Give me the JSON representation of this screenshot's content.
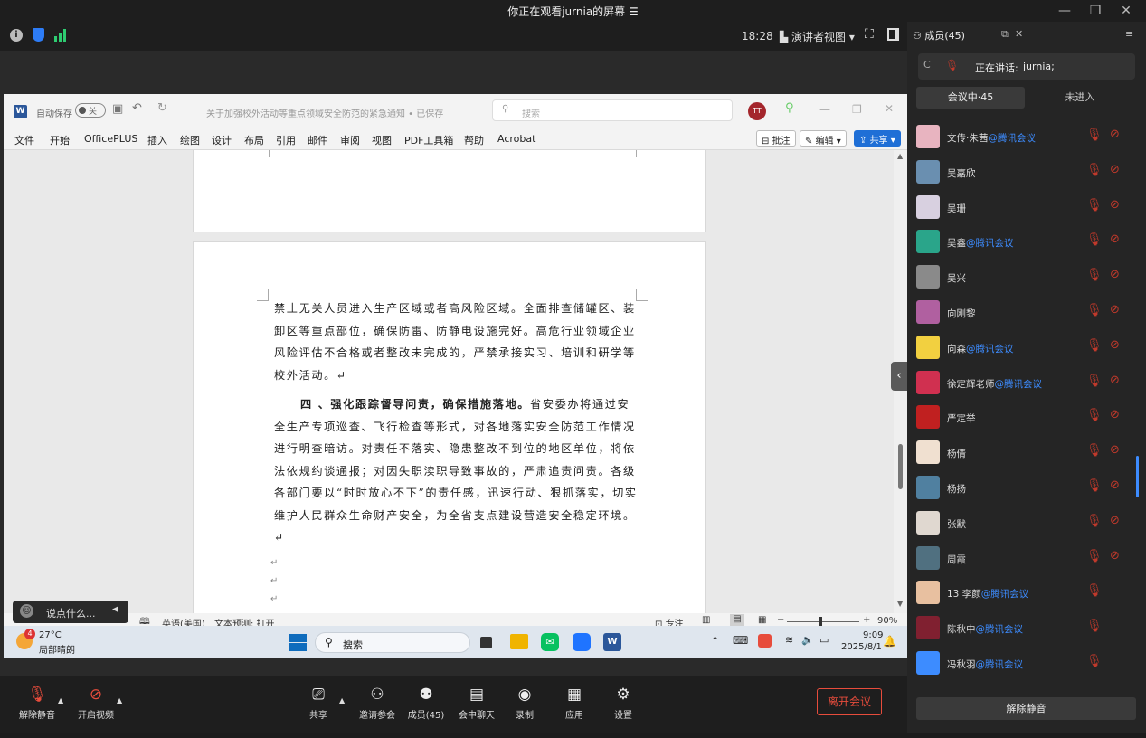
{
  "window": {
    "title": "你正在观看jurnia的屏幕"
  },
  "meeting_bar": {
    "time": "18:28",
    "view_mode": "演讲者视图"
  },
  "word": {
    "autosave_label": "自动保存",
    "autosave_state": "关",
    "doc_title": "关于加强校外活动等重点领域安全防范的紧急通知 • 已保存",
    "search_placeholder": "搜索",
    "avatar_initials": "TT",
    "menu": [
      "文件",
      "开始",
      "OfficePLUS",
      "插入",
      "绘图",
      "设计",
      "布局",
      "引用",
      "邮件",
      "审阅",
      "视图",
      "PDF工具箱",
      "帮助",
      "Acrobat"
    ],
    "comment_button": "批注",
    "edit_button": "编辑",
    "share_button": "共享",
    "paragraph1": "禁止无关人员进入生产区域或者高风险区域。全面排查储罐区、装卸区等重点部位，确保防雷、防静电设施完好。高危行业领域企业风险评估不合格或者整改未完成的，严禁承接实习、培训和研学等校外活动。↵",
    "heading2": "四 、强化跟踪督导问责，确保措施落地。",
    "paragraph2": "省安委办将通过安全生产专项巡查、飞行检查等形式，对各地落实安全防范工作情况进行明查暗访。对责任不落实、隐患整改不到位的地区单位，将依法依规约谈通报；对因失职渎职导致事故的，严肃追责问责。各级各部门要以“时时放心不下”的责任感，迅速行动、狠抓落实，切实维护人民群众生命财产安全，为全省支点建设营造安全稳定环境。↵",
    "empty_marks": [
      "↵",
      "↵",
      "↵"
    ],
    "status": {
      "language": "英语(美国)",
      "prediction": "文本预测: 打开",
      "focus": "专注",
      "zoom": "90%"
    }
  },
  "chat_input": {
    "placeholder": "说点什么..."
  },
  "taskbar": {
    "weather_temp": "27°C",
    "weather_desc": "局部晴朗",
    "weather_badge": "4",
    "search": "搜索",
    "time": "9:09",
    "date": "2025/8/1"
  },
  "bottom_bar": {
    "unmute": "解除静音",
    "video": "开启视频",
    "share": "共享",
    "invite": "邀请参会",
    "members": "成员(45)",
    "chat": "会中聊天",
    "record": "录制",
    "apps": "应用",
    "settings": "设置",
    "leave": "离开会议"
  },
  "panel": {
    "title": "成员(45)",
    "speaking_label": "正在讲话:",
    "speaking_name": "jurnia;",
    "tab_in": "会议中·45",
    "tab_out": "未进入",
    "unmute_button": "解除静音",
    "members": [
      {
        "name": "文传·朱茜",
        "tag": "@腾讯会议",
        "color": "#e8b4c0",
        "cam": true
      },
      {
        "name": "吴嘉欣",
        "tag": "",
        "color": "#6a8fb0",
        "cam": true
      },
      {
        "name": "吴珊",
        "tag": "",
        "color": "#d8d0e0",
        "cam": true
      },
      {
        "name": "吴鑫",
        "tag": "@腾讯会议",
        "color": "#2aa58a",
        "cam": true
      },
      {
        "name": "吴兴",
        "tag": "",
        "color": "#8a8a8a",
        "cam": true
      },
      {
        "name": "向刚黎",
        "tag": "",
        "color": "#b060a0",
        "cam": true
      },
      {
        "name": "向森",
        "tag": "@腾讯会议",
        "color": "#f2d040",
        "cam": true
      },
      {
        "name": "徐定辉老师",
        "tag": "@腾讯会议",
        "color": "#d03050",
        "cam": true
      },
      {
        "name": "严定举",
        "tag": "",
        "color": "#c02020",
        "cam": true
      },
      {
        "name": "杨倩",
        "tag": "",
        "color": "#f0e0d0",
        "cam": true
      },
      {
        "name": "杨扬",
        "tag": "",
        "color": "#5080a0",
        "cam": true
      },
      {
        "name": "张默",
        "tag": "",
        "color": "#e0d8d0",
        "cam": true
      },
      {
        "name": "周霞",
        "tag": "",
        "color": "#507080",
        "cam": true
      },
      {
        "name": "13 李颜",
        "tag": "@腾讯会议",
        "color": "#e8c0a0",
        "cam": false
      },
      {
        "name": "陈秋中",
        "tag": "@腾讯会议",
        "color": "#802030",
        "cam": false
      },
      {
        "name": "冯秋羽",
        "tag": "@腾讯会议",
        "color": "#3d8cff",
        "cam": false
      }
    ]
  }
}
